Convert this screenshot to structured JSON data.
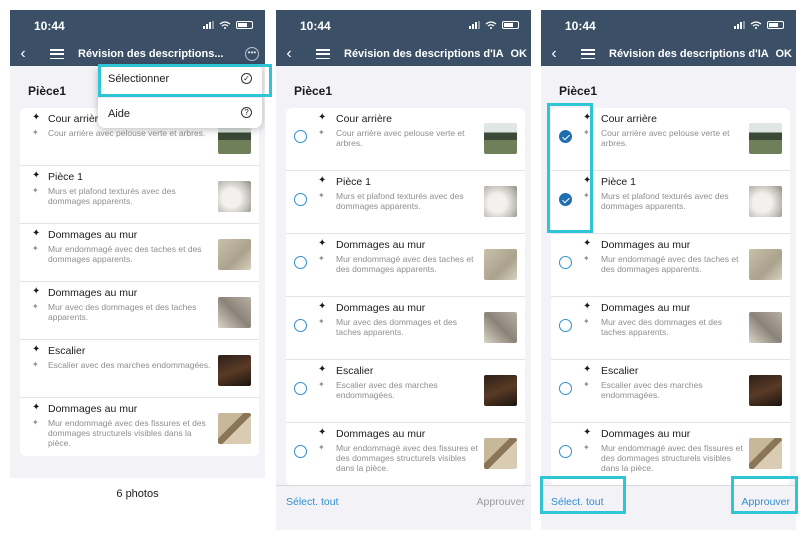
{
  "status_time": "10:44",
  "screens": {
    "one": {
      "nav_title": "Révision des descriptions...",
      "section": "Pièce1",
      "menu": {
        "select": "Sélectionner",
        "help": "Aide"
      },
      "footer": "6 photos"
    },
    "two": {
      "nav_title": "Révision des descriptions d'IA",
      "nav_ok": "OK",
      "section": "Pièce1",
      "footer_left": "Sélect. tout",
      "footer_right": "Approuver"
    },
    "three": {
      "nav_title": "Révision des descriptions d'IA",
      "nav_ok": "OK",
      "section": "Pièce1",
      "footer_left": "Sélect. tout",
      "footer_right": "Approuver"
    }
  },
  "items": [
    {
      "title": "Cour arrière",
      "desc": "Cour arrière avec pelouse verte et arbres.",
      "thumb": "garden-thumbnail"
    },
    {
      "title": "Pièce 1",
      "desc": "Murs et plafond texturés avec des dommages apparents.",
      "thumb": "room-thumbnail"
    },
    {
      "title": "Dommages au mur",
      "desc": "Mur endommagé avec des taches et des dommages apparents.",
      "thumb": "wall-thumbnail"
    },
    {
      "title": "Dommages au mur",
      "desc": "Mur avec des dommages et des taches apparents.",
      "thumb": "wall-thumbnail"
    },
    {
      "title": "Escalier",
      "desc": "Escalier avec des marches endommagées.",
      "thumb": "stairs-thumbnail"
    },
    {
      "title": "Dommages au mur",
      "desc": "Mur endommagé avec des fissures et des dommages structurels visibles dans la pièce.",
      "thumb": "crack-thumbnail"
    }
  ],
  "screen3_checked": [
    true,
    true,
    false,
    false,
    false,
    false
  ],
  "icons": {
    "back": "‹",
    "sparkle": "✦",
    "check_circle": "check-circle-icon",
    "help": "help-icon",
    "more": "more-icon"
  },
  "colors": {
    "topbar": "#3b4f66",
    "accent": "#2f8fd0",
    "highlight": "#2ec6d6",
    "disabled": "#9a9aa0"
  }
}
